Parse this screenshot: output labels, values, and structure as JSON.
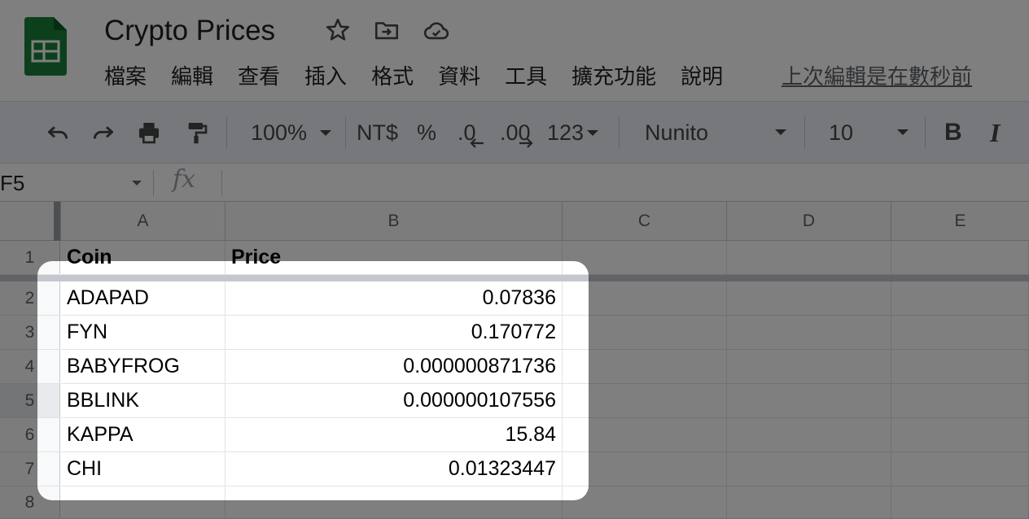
{
  "document": {
    "title": "Crypto Prices",
    "last_edit": "上次編輯是在數秒前"
  },
  "title_icons": [
    "star-icon",
    "move-to-folder-icon",
    "cloud-saved-icon"
  ],
  "menu": [
    "檔案",
    "編輯",
    "查看",
    "插入",
    "格式",
    "資料",
    "工具",
    "擴充功能",
    "說明"
  ],
  "toolbar": {
    "zoom": "100%",
    "currency": "NT$",
    "percent": "%",
    "decrease_decimal": ".0",
    "increase_decimal": ".00",
    "number_format": "123",
    "font": "Nunito",
    "font_size": "10",
    "bold": "B",
    "italic": "I"
  },
  "formula_bar": {
    "cell_ref": "F5",
    "fx": "fx",
    "content": ""
  },
  "sheet": {
    "columns": [
      "A",
      "B",
      "C",
      "D",
      "E"
    ],
    "rows": [
      "1",
      "2",
      "3",
      "4",
      "5",
      "6",
      "7",
      "8"
    ],
    "header": [
      "Coin",
      "Price"
    ],
    "data": [
      [
        "ADAPAD",
        "0.07836"
      ],
      [
        "FYN",
        "0.170772"
      ],
      [
        "BABYFROG",
        "0.000000871736"
      ],
      [
        "BBLINK",
        "0.000000107556"
      ],
      [
        "KAPPA",
        "15.84"
      ],
      [
        "CHI",
        "0.01323447"
      ]
    ]
  },
  "colors": {
    "logo_green": "#188038",
    "toolbar_bg": "#eef1f6",
    "overlay": "rgba(0,0,0,0.5)"
  }
}
